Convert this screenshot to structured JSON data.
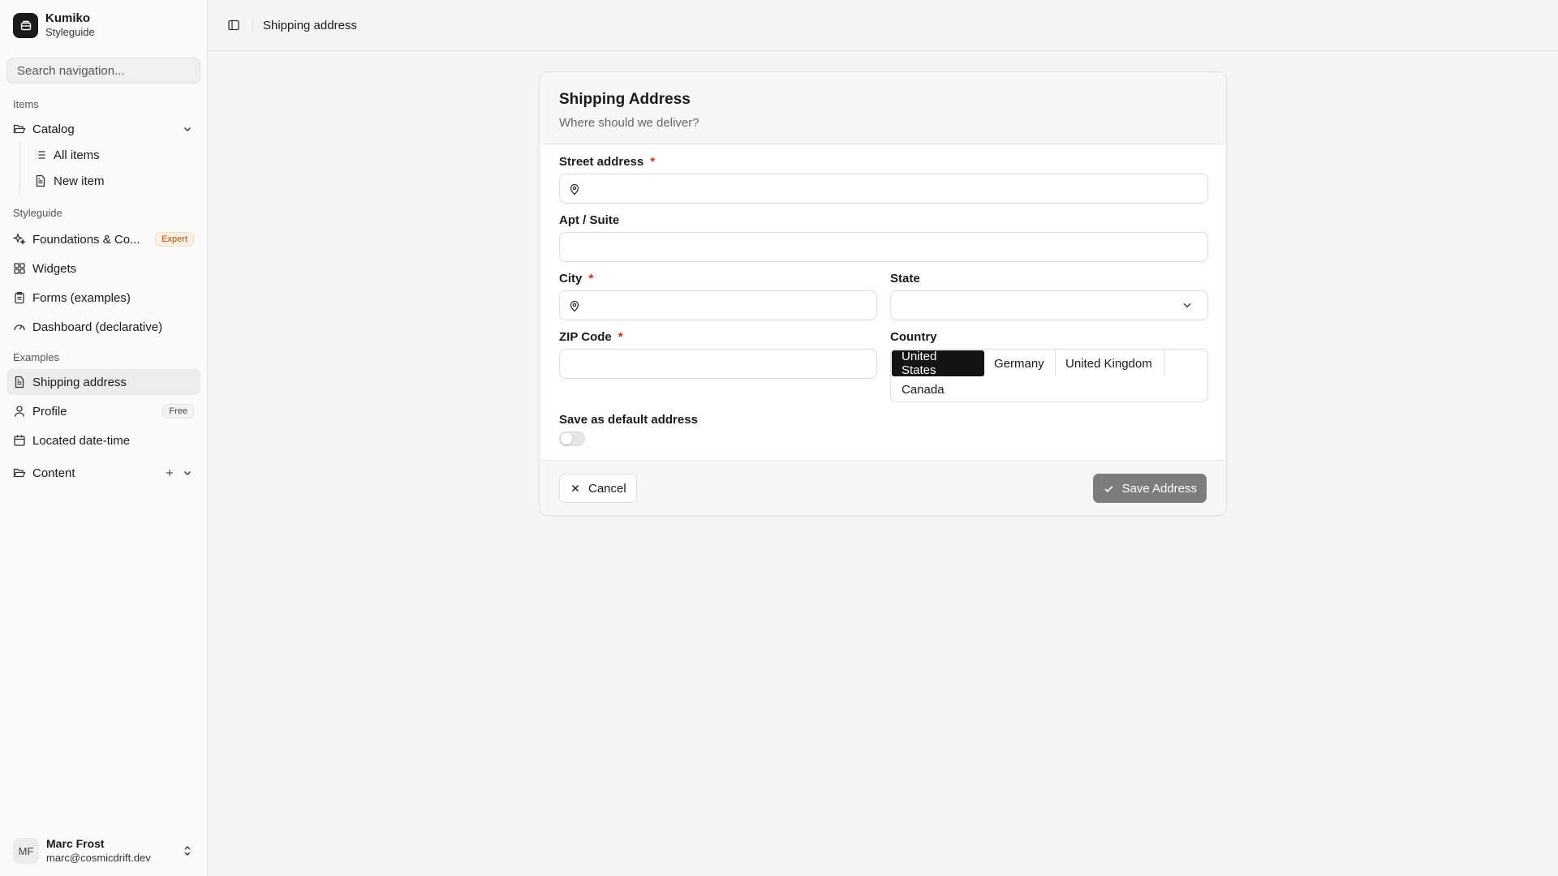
{
  "brand": {
    "title": "Kumiko",
    "subtitle": "Styleguide"
  },
  "search": {
    "placeholder": "Search navigation..."
  },
  "sidebar": {
    "groups": [
      {
        "label": "Items"
      },
      {
        "label": "Styleguide"
      },
      {
        "label": "Examples"
      }
    ],
    "catalog": {
      "label": "Catalog",
      "children": [
        {
          "label": "All items"
        },
        {
          "label": "New item"
        }
      ]
    },
    "styleguide_items": [
      {
        "label": "Foundations & Co...",
        "badge": "Expert"
      },
      {
        "label": "Widgets"
      },
      {
        "label": "Forms (examples)"
      },
      {
        "label": "Dashboard (declarative)"
      }
    ],
    "example_items": [
      {
        "label": "Shipping address"
      },
      {
        "label": "Profile",
        "badge": "Free"
      },
      {
        "label": "Located date-time"
      }
    ],
    "content": {
      "label": "Content"
    }
  },
  "user": {
    "initials": "MF",
    "name": "Marc Frost",
    "email": "marc@cosmicdrift.dev"
  },
  "topbar": {
    "breadcrumb": "Shipping address"
  },
  "form": {
    "title": "Shipping Address",
    "description": "Where should we deliver?",
    "street": {
      "label": "Street address",
      "required_mark": "*",
      "value": ""
    },
    "apt": {
      "label": "Apt / Suite",
      "value": ""
    },
    "city": {
      "label": "City",
      "required_mark": "*",
      "value": ""
    },
    "state": {
      "label": "State",
      "value": ""
    },
    "zip": {
      "label": "ZIP Code",
      "required_mark": "*",
      "value": ""
    },
    "country": {
      "label": "Country",
      "options": [
        "United States",
        "Germany",
        "United Kingdom",
        "Canada"
      ],
      "selected": "United States"
    },
    "default_address": {
      "label": "Save as default address",
      "checked": false
    },
    "cancel_label": "Cancel",
    "save_label": "Save Address"
  },
  "colors": {
    "accent_dark": "#141414",
    "required": "#dc2626",
    "expert_badge": "#c2410c",
    "save_button": "#7d7d7d"
  }
}
